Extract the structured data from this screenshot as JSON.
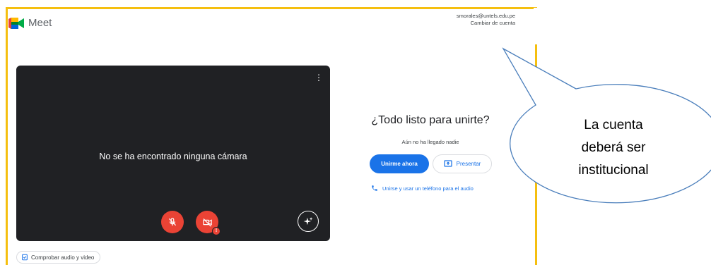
{
  "app": {
    "name": "Meet"
  },
  "account": {
    "email": "smorales@untels.edu.pe",
    "switch_label": "Cambiar de cuenta"
  },
  "preview": {
    "message": "No se ha encontrado ninguna cámara",
    "more_icon": "more-vert-icon",
    "mic_icon": "mic-off-icon",
    "camera_icon": "videocam-off-icon",
    "camera_warning": "!",
    "effects_icon": "sparkle-effects-icon"
  },
  "check_audio_video": {
    "label": "Comprobar audio y video",
    "icon": "settings-check-icon"
  },
  "join_panel": {
    "title": "¿Todo listo para unirte?",
    "status": "Aún no ha llegado nadie",
    "join_label": "Unirme ahora",
    "present_label": "Presentar",
    "phone_label": "Unirse y usar un teléfono para el audio"
  },
  "callout": {
    "lines": [
      "La cuenta",
      "deberá ser",
      "institucional"
    ]
  },
  "colors": {
    "highlight_frame": "#f5bf0f",
    "meet_blue": "#1a73e8",
    "danger_red": "#ea4335",
    "callout_border": "#4a7ebb",
    "video_bg": "#202124"
  }
}
